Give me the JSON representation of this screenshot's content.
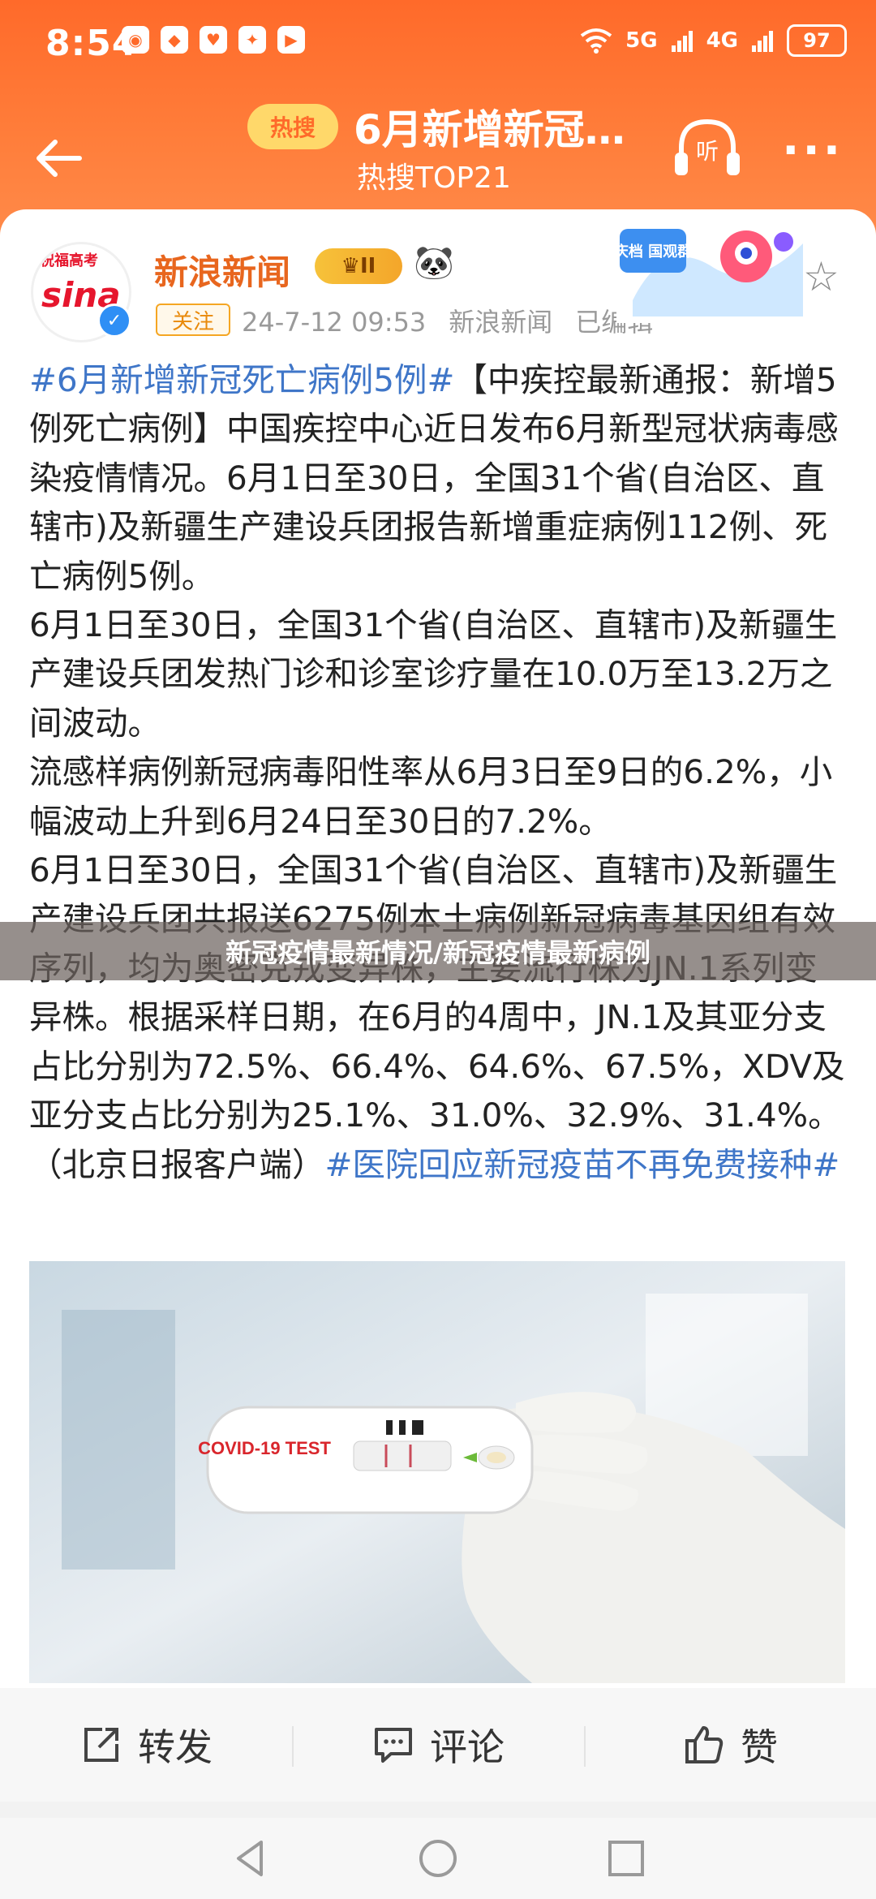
{
  "status_bar": {
    "time": "8:54",
    "app_icons": [
      "weibo-icon",
      "app-icon",
      "app-icon",
      "app-icon",
      "app-icon"
    ],
    "network_1": "5G",
    "network_2": "4G",
    "battery": "97"
  },
  "nav": {
    "hot_badge": "热搜",
    "title": "6月新增新冠…",
    "subtitle": "热搜TOP21",
    "listen_label": "听",
    "more_label": "···"
  },
  "post": {
    "avatar_text": "sina",
    "avatar_badge": "祝福高考",
    "author": "新浪新闻",
    "level_badge": "II",
    "follow_label": "关注",
    "date": "24-7-12 09:53",
    "source": "新浪新闻",
    "edited": "已编辑",
    "sticker_text": "国庆档 国观群众",
    "paragraph1_tag": "#6月新增新冠死亡病例5例#",
    "paragraph1_text": "【中疾控最新通报：新增5例死亡病例】中国疾控中心近日发布6月新型冠状病毒感染疫情情况。6月1日至30日，全国31个省(自治区、直辖市)及新疆生产建设兵团报告新增重症病例112例、死亡病例5例。",
    "paragraph2": "6月1日至30日，全国31个省(自治区、直辖市)及新疆生产建设兵团发热门诊和诊室诊疗量在10.0万至13.2万之间波动。",
    "paragraph3": "流感样病例新冠病毒阳性率从6月3日至9日的6.2%，小幅波动上升到6月24日至30日的7.2%。",
    "paragraph4_text": "6月1日至30日，全国31个省(自治区、直辖市)及新疆生产建设兵团共报送6275例本土病例新冠病毒基因组有效序列，均为奥密克戎变异株，主要流行株为JN.1系列变异株。根据采样日期，在6月的4周中，JN.1及其亚分支占比分别为72.5%、66.4%、64.6%、67.5%，XDV及亚分支占比分别为25.1%、31.0%、32.9%、31.4%。（北京日报客户端）",
    "paragraph4_tag": "#医院回应新冠疫苗不再免费接种#",
    "image_text": "COVID-19 TEST"
  },
  "watermark": "新冠疫情最新情况/新冠疫情最新病例",
  "actions": {
    "repost": "转发",
    "comment": "评论",
    "like": "赞"
  },
  "colors": {
    "header_orange": "#ff6a2a",
    "author_orange": "#e8661e",
    "tag_blue": "#3f76c8"
  }
}
